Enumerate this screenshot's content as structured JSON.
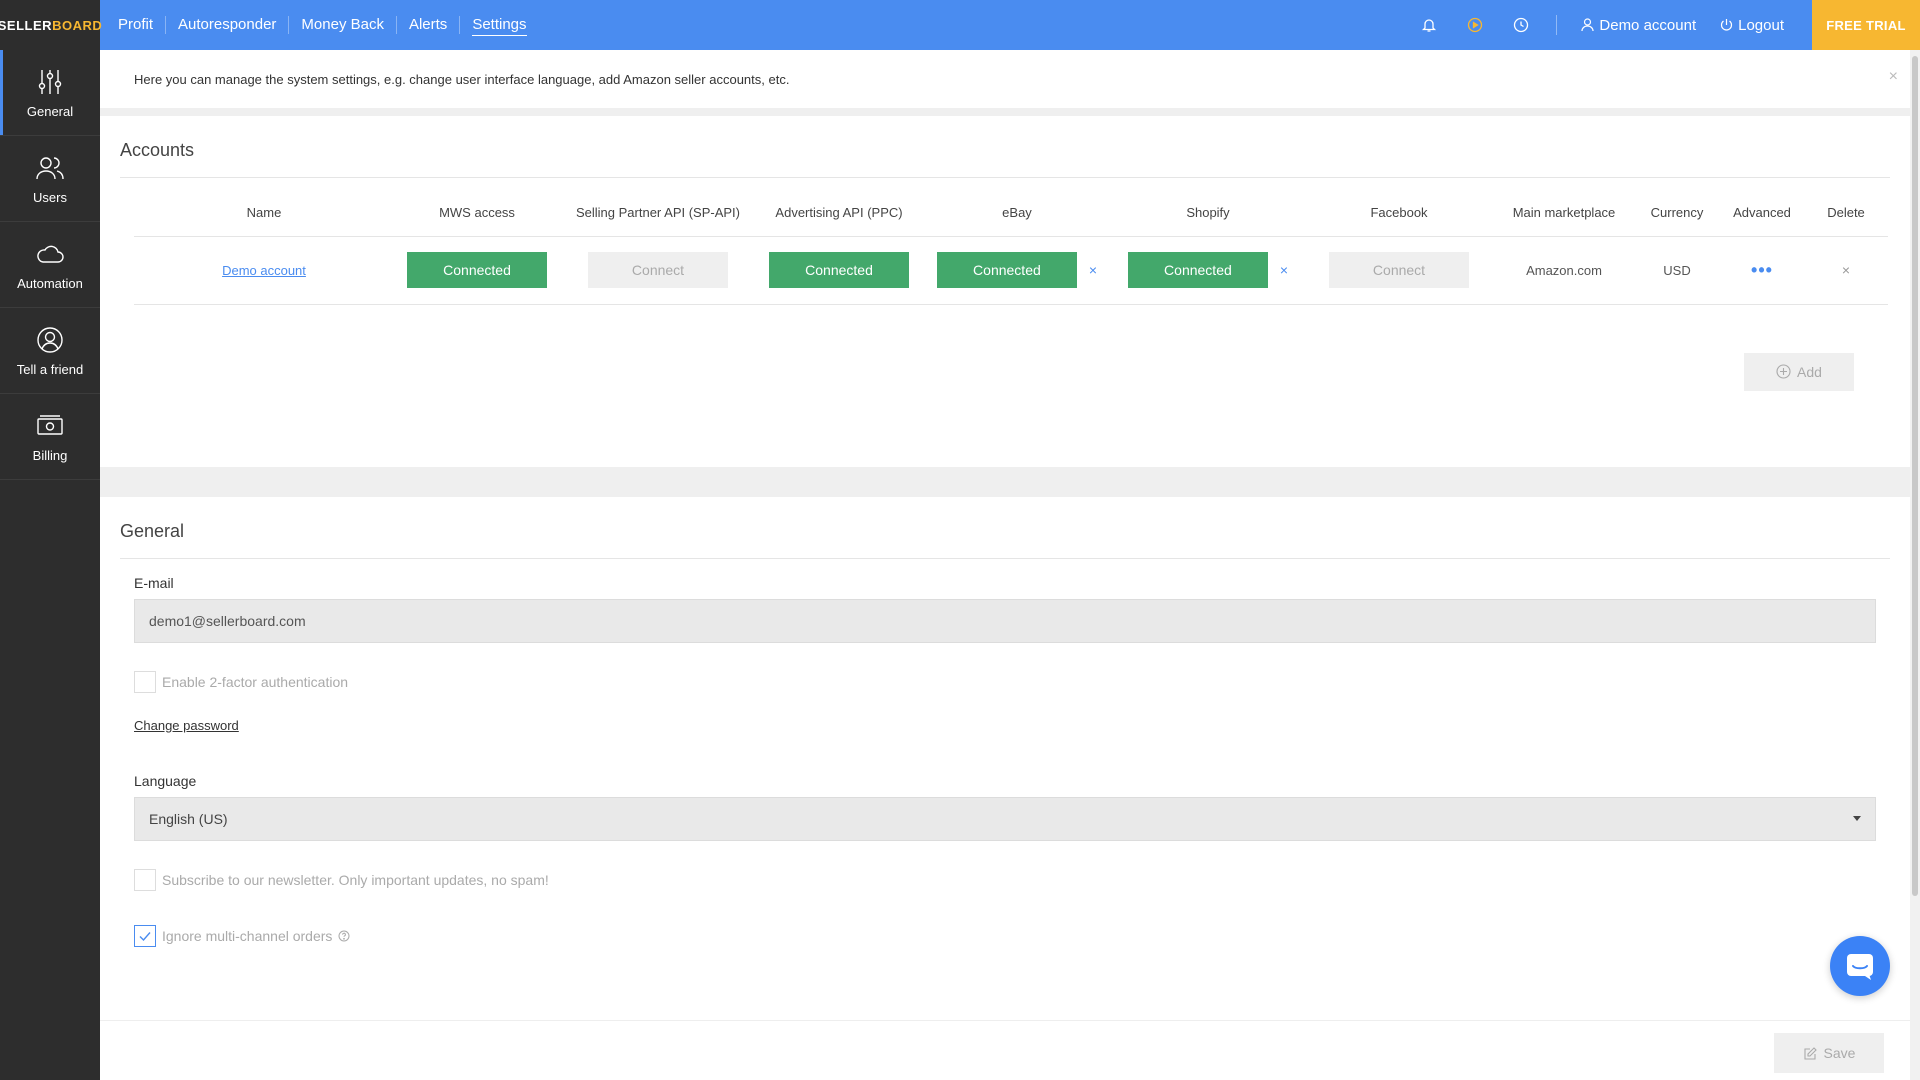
{
  "brand": {
    "part1": "SELLER",
    "part2": "BOARD"
  },
  "nav": {
    "items": [
      "Profit",
      "Autoresponder",
      "Money Back",
      "Alerts",
      "Settings"
    ],
    "active": "Settings"
  },
  "topbar": {
    "account_label": "Demo account",
    "logout_label": "Logout",
    "free_trial_label": "FREE TRIAL",
    "icons": [
      "bell-icon",
      "play-icon",
      "clock-icon"
    ]
  },
  "sidebar": {
    "items": [
      {
        "label": "General",
        "icon": "sliders-icon"
      },
      {
        "label": "Users",
        "icon": "users-icon"
      },
      {
        "label": "Automation",
        "icon": "cloud-icon"
      },
      {
        "label": "Tell a friend",
        "icon": "user-circle-icon"
      },
      {
        "label": "Billing",
        "icon": "money-icon"
      }
    ]
  },
  "info": {
    "text": "Here you can manage the system settings, e.g. change user interface language, add Amazon seller accounts, etc.",
    "close": "×"
  },
  "accounts": {
    "title": "Accounts",
    "headers": [
      "Name",
      "MWS access",
      "Selling Partner API (SP-API)",
      "Advertising API (PPC)",
      "eBay",
      "Shopify",
      "Facebook",
      "Main marketplace",
      "Currency",
      "Advanced",
      "Delete"
    ],
    "row": {
      "name": "Demo account",
      "mws": "Connected",
      "spapi": "Connect",
      "ppc": "Connected",
      "ebay": "Connected",
      "shopify": "Connected",
      "facebook": "Connect",
      "marketplace": "Amazon.com",
      "currency": "USD",
      "advanced": "•••",
      "delete": "×",
      "x": "×"
    },
    "add_label": "Add"
  },
  "general": {
    "title": "General",
    "email_label": "E-mail",
    "email_value": "demo1@sellerboard.com",
    "twofa_label": "Enable 2-factor authentication",
    "change_password": "Change password",
    "language_label": "Language",
    "language_value": "English (US)",
    "newsletter_label": "Subscribe to our newsletter. Only important updates, no spam!",
    "multichannel_label": "Ignore multi-channel orders"
  },
  "save_label": "Save"
}
